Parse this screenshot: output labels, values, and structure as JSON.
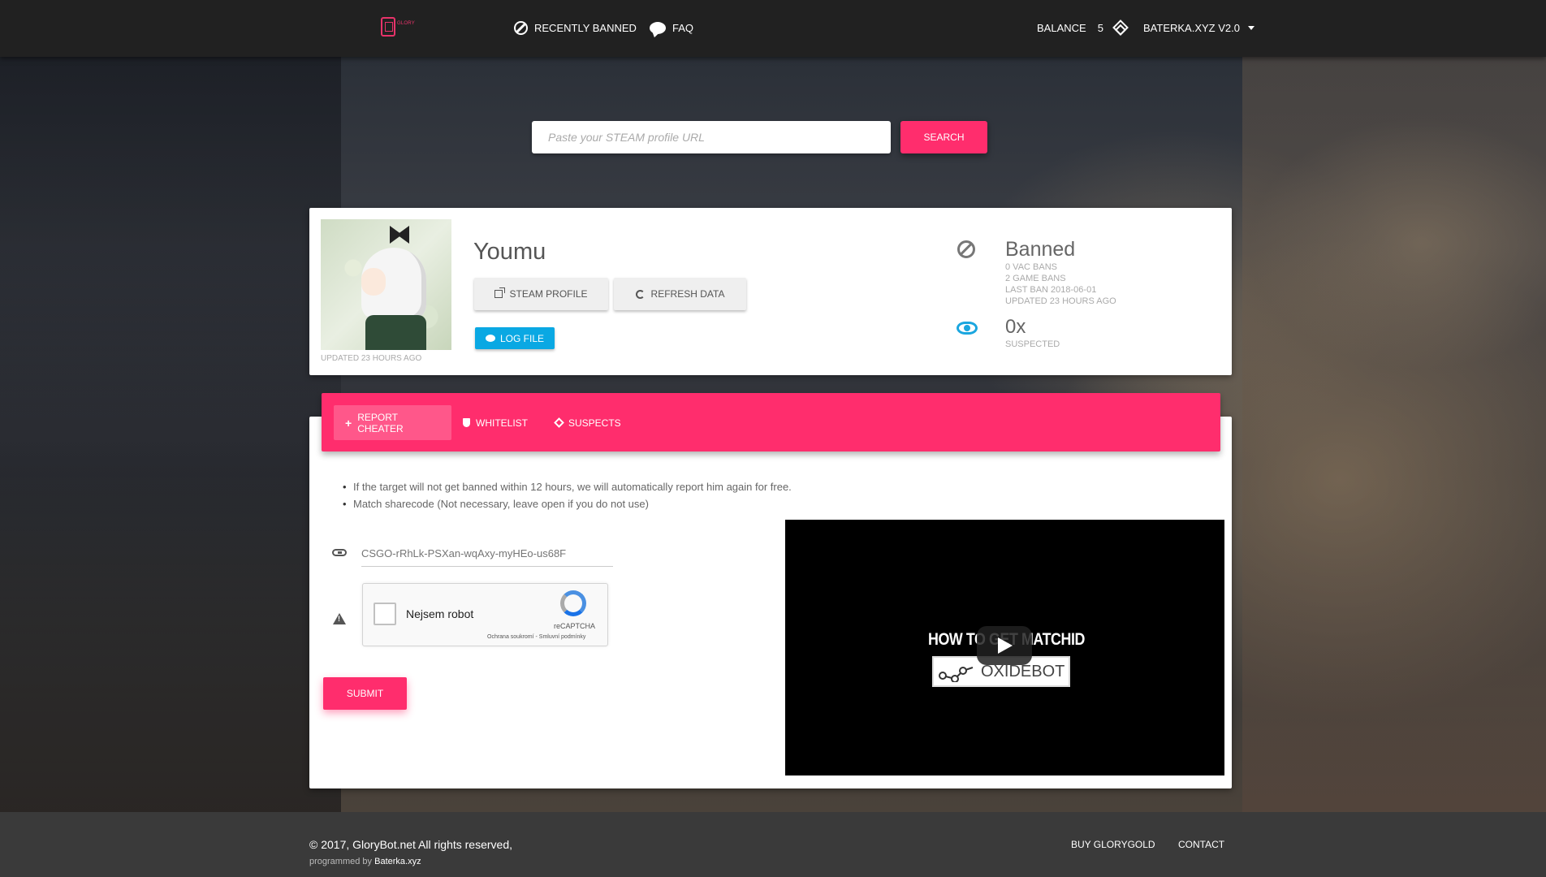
{
  "nav": {
    "logo_text": "GLORY",
    "recently_banned": "RECENTLY BANNED",
    "faq": "FAQ",
    "balance_label": "BALANCE",
    "balance_value": "5",
    "user_menu": "BATERKA.XYZ V2.0"
  },
  "search": {
    "placeholder": "Paste your STEAM profile URL",
    "button": "SEARCH"
  },
  "profile": {
    "name": "Youmu",
    "avatar_updated": "UPDATED 23 HOURS AGO",
    "steam_profile_button": "STEAM PROFILE",
    "refresh_button": "REFRESH DATA",
    "log_file_button": "LOG FILE",
    "status": "Banned",
    "vac_bans": "0 VAC BANS",
    "game_bans": "2 GAME BANS",
    "last_ban": "LAST BAN 2018-06-01",
    "updated": "UPDATED 23 HOURS AGO",
    "suspected_count": "0x",
    "suspected_label": "SUSPECTED"
  },
  "tabs": [
    {
      "label": "REPORT CHEATER",
      "active": true
    },
    {
      "label": "WHITELIST",
      "active": false
    },
    {
      "label": "SUSPECTS",
      "active": false
    }
  ],
  "report": {
    "notes": [
      "If the target will not get banned within 12 hours, we will automatically report him again for free.",
      "Match sharecode (Not necessary, leave open if you do not use)"
    ],
    "sharecode_placeholder": "CSGO-rRhLk-PSXan-wqAxy-myHEo-us68F",
    "captcha_label": "Nejsem robot",
    "captcha_brand": "reCAPTCHA",
    "captcha_terms": "Ochrana soukromí - Smluvní podmínky",
    "submit": "SUBMIT"
  },
  "video": {
    "title": "HOW TO GET MATCHID",
    "logo_text": "OXIDEBOT"
  },
  "footer": {
    "copyright": "© 2017, GloryBot.net All rights reserved,",
    "programmed_by_label": "programmed by",
    "programmed_by_name": "Baterka.xyz",
    "buy_link": "BUY GLORYGOLD",
    "contact_link": "CONTACT"
  },
  "colors": {
    "accent": "#ff2d6d",
    "info": "#0aa8e3",
    "navbar": "#212121"
  }
}
